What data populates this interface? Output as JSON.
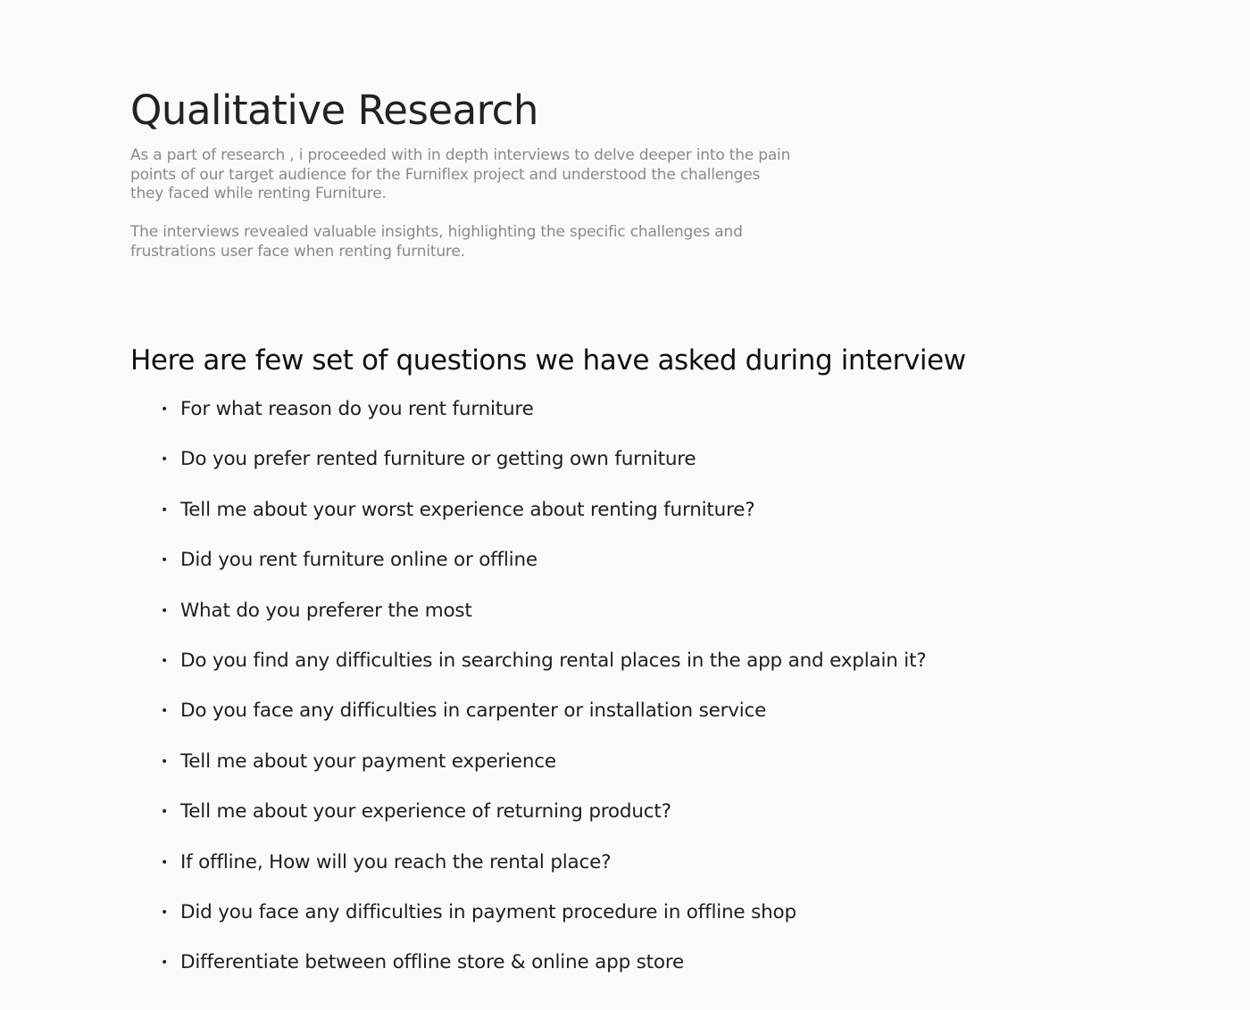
{
  "title": "Qualitative Research",
  "intro": {
    "paragraph_1": "As a part of research , i proceeded with in depth interviews to delve deeper into the pain points of our target audience for the Furniflex project and understood the challenges they faced while renting Furniture.",
    "paragraph_2": "The interviews revealed valuable insights, highlighting the specific challenges and frustrations user face when renting furniture."
  },
  "questions_heading": "Here are few set of questions we have asked during interview",
  "bullet_symbol": "•",
  "questions": [
    "For what reason do you rent furniture",
    "Do you prefer rented furniture or getting own furniture",
    "Tell me about your worst experience about renting furniture?",
    "Did you rent furniture online or offline",
    "What do you preferer the most",
    "Do you find any difficulties in searching rental places in the app and explain it?",
    "Do you face any difficulties in carpenter or installation service",
    "Tell me about your payment experience",
    "Tell me about your experience of returning product?",
    "If offline, How will you reach the rental place?",
    "Did you face any difficulties in payment procedure in offline shop",
    "Differentiate between offline store & online app store"
  ]
}
